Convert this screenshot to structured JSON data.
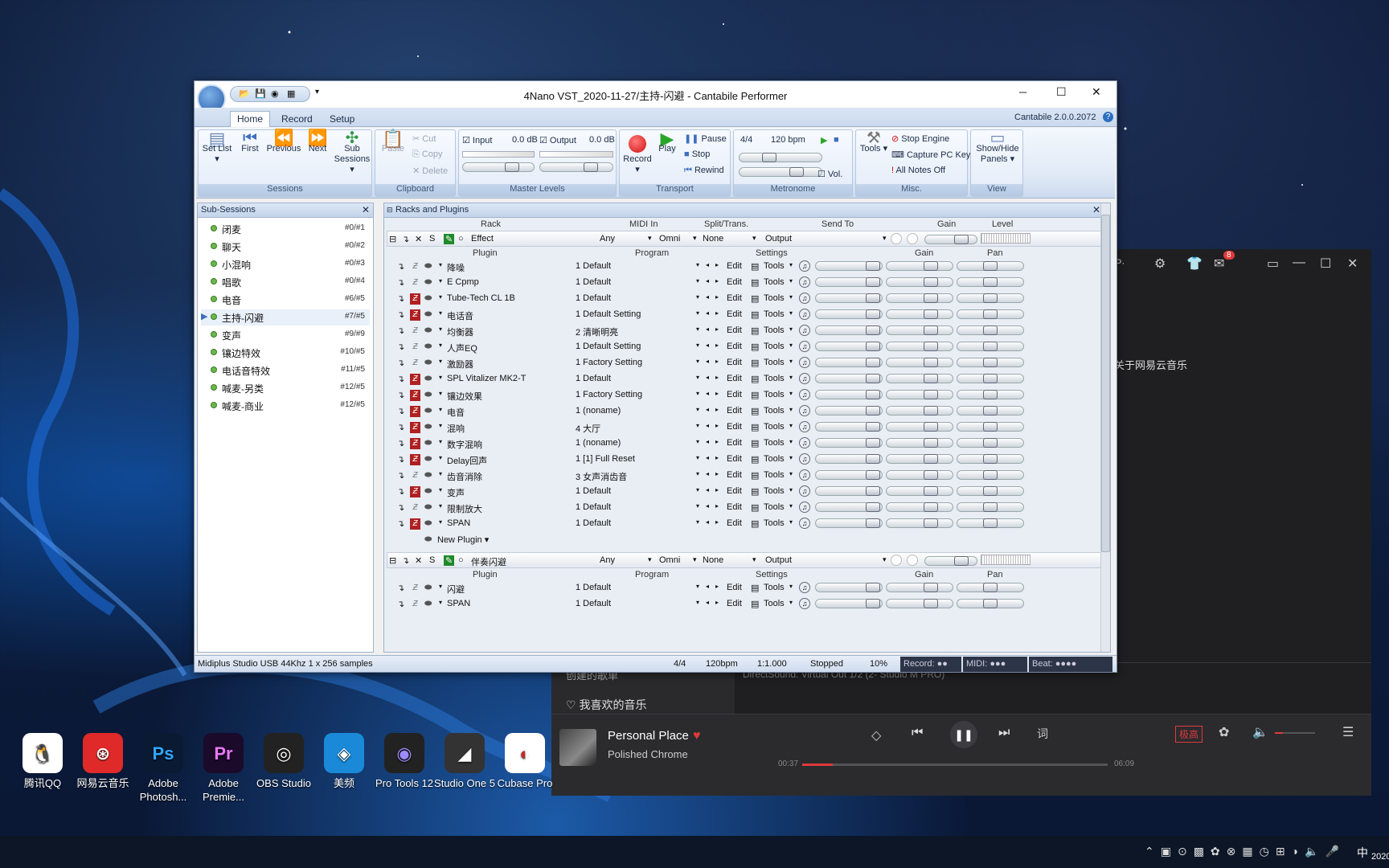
{
  "window": {
    "title": "4Nano VST_2020-11-27/主持-闪避 - Cantabile Performer",
    "version": "Cantabile 2.0.0.2072",
    "minimize": "─",
    "maximize": "☐",
    "close": "✕"
  },
  "ribbon": {
    "tabs": [
      "Home",
      "Record",
      "Setup"
    ],
    "sessions": {
      "label": "Sessions",
      "set_list": "Set List ▾",
      "first": "First",
      "previous": "Previous",
      "next": "Next",
      "sub_sessions": "Sub Sessions ▾"
    },
    "clipboard": {
      "label": "Clipboard",
      "paste": "Paste",
      "cut": "Cut",
      "copy": "Copy",
      "delete": "Delete"
    },
    "master": {
      "label": "Master Levels",
      "input": "Input",
      "input_db": "0.0 dB",
      "output": "Output",
      "output_db": "0.0 dB"
    },
    "transport": {
      "label": "Transport",
      "record": "Record ▾",
      "play": "Play",
      "pause": "Pause",
      "stop": "Stop",
      "rewind": "Rewind"
    },
    "metronome": {
      "label": "Metronome",
      "sig": "4/4",
      "bpm": "120 bpm",
      "vol": "Vol."
    },
    "misc": {
      "label": "Misc.",
      "tools": "Tools ▾",
      "stop_engine": "Stop Engine",
      "capture": "Capture PC Keys",
      "notes_off": "All Notes Off"
    },
    "view": {
      "label": "View",
      "show_hide": "Show/Hide Panels ▾"
    }
  },
  "subsessions": {
    "title": "Sub-Sessions",
    "items": [
      {
        "name": "闭麦",
        "no": "#0/#1"
      },
      {
        "name": "聊天",
        "no": "#0/#2"
      },
      {
        "name": "小混响",
        "no": "#0/#3"
      },
      {
        "name": "唱歌",
        "no": "#0/#4"
      },
      {
        "name": "电音",
        "no": "#6/#5"
      },
      {
        "name": "主持-闪避",
        "no": "#7/#5"
      },
      {
        "name": "变声",
        "no": "#9/#9"
      },
      {
        "name": "镶边特效",
        "no": "#10/#5"
      },
      {
        "name": "电话音特效",
        "no": "#11/#5"
      },
      {
        "name": "喊麦-另类",
        "no": "#12/#5"
      },
      {
        "name": "喊麦-商业",
        "no": "#12/#5"
      }
    ]
  },
  "racks": {
    "title": "Racks and Plugins",
    "headers": {
      "rack": "Rack",
      "midi_in": "MIDI In",
      "split": "Split/Trans.",
      "send_to": "Send To",
      "gain": "Gain",
      "level": "Level"
    },
    "plugin_headers": {
      "plugin": "Plugin",
      "program": "Program",
      "settings": "Settings",
      "gain": "Gain",
      "pan": "Pan"
    },
    "rack1": {
      "name": "Effect",
      "midi": "Any",
      "omni": "Omni",
      "split": "None",
      "send": "Output"
    },
    "plugins1": [
      {
        "name": "降噪",
        "prog": "1 Default",
        "on": false
      },
      {
        "name": "E Cpmp",
        "prog": "1 Default",
        "on": false
      },
      {
        "name": "Tube-Tech CL 1B",
        "prog": "1 Default",
        "on": true
      },
      {
        "name": "电话音",
        "prog": "1 Default Setting",
        "on": true
      },
      {
        "name": "均衡器",
        "prog": "2 清晰明亮",
        "on": false
      },
      {
        "name": "人声EQ",
        "prog": "1 Default Setting",
        "on": false
      },
      {
        "name": "激励器",
        "prog": "1 Factory Setting",
        "on": false
      },
      {
        "name": "SPL Vitalizer MK2-T",
        "prog": "1 Default",
        "on": true
      },
      {
        "name": "镶边效果",
        "prog": "1 Factory Setting",
        "on": true
      },
      {
        "name": "电音",
        "prog": "1 (noname)",
        "on": true
      },
      {
        "name": "混响",
        "prog": "4 大厅",
        "on": true
      },
      {
        "name": "数字混响",
        "prog": "1 (noname)",
        "on": true
      },
      {
        "name": "Delay回声",
        "prog": "1 [1] Full Reset",
        "on": true
      },
      {
        "name": "齿音消除",
        "prog": "3 女声消齿音",
        "on": false
      },
      {
        "name": "变声",
        "prog": "1 Default",
        "on": true
      },
      {
        "name": "限制放大",
        "prog": "1 Default",
        "on": false
      },
      {
        "name": "SPAN",
        "prog": "1 Default",
        "on": true
      }
    ],
    "new_plugin": "New Plugin ▾",
    "rack2": {
      "name": "伴奏闪避",
      "midi": "Any",
      "omni": "Omni",
      "split": "None",
      "send": "Output"
    },
    "plugins2": [
      {
        "name": "闪避",
        "prog": "1 Default",
        "on": false
      },
      {
        "name": "SPAN",
        "prog": "1 Default",
        "on": false
      }
    ],
    "edit": "Edit",
    "tools": "Tools"
  },
  "status": {
    "device": "Midiplus Studio USB 44Khz 1 x 256 samples",
    "sig": "4/4",
    "bpm": "120bpm",
    "pos": "1:1.000",
    "state": "Stopped",
    "cpu": "10%",
    "record": "Record:",
    "midi": "MIDI:",
    "beat": "Beat:"
  },
  "music": {
    "created": "创建的歌单",
    "liked": "我喜欢的音乐",
    "about": "关于网易云音乐",
    "vip": "VIP·",
    "badge": "8",
    "output": "DirectSound: Virtual Out 1/2 (2- Studio M PRO)",
    "song": "Personal Place",
    "artist": "Polished Chrome",
    "elapsed": "00:37",
    "total": "06:09",
    "progress": 0.1,
    "quality": "极高",
    "lyric": "词"
  },
  "desktop": [
    {
      "label": "腾讯QQ"
    },
    {
      "label": "网易云音乐"
    },
    {
      "label": "Adobe Photosh..."
    },
    {
      "label": "Adobe Premie..."
    },
    {
      "label": "OBS Studio"
    },
    {
      "label": "美频"
    },
    {
      "label": "Pro Tools 12"
    },
    {
      "label": "Studio One 5"
    },
    {
      "label": "Cubase Pro"
    }
  ],
  "tray": {
    "ime": "中",
    "date": "2020"
  },
  "colors": {
    "accent": "#2f6fbf",
    "record": "#e02020",
    "play": "#2aa52a",
    "music_red": "#e03a3a"
  }
}
